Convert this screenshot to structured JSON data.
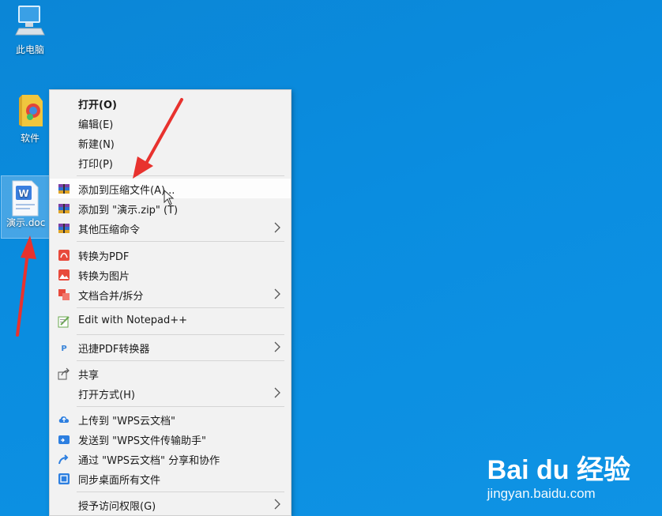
{
  "desktop": {
    "icons": [
      {
        "label": "此电脑",
        "icon": "pc-icon"
      },
      {
        "label": "软件",
        "icon": "folder-icon"
      },
      {
        "label": "演示.doc",
        "icon": "wps-doc-icon"
      }
    ]
  },
  "menu": {
    "items": [
      {
        "label": "打开(O)",
        "bold": true
      },
      {
        "label": "编辑(E)"
      },
      {
        "label": "新建(N)"
      },
      {
        "label": "打印(P)"
      },
      {
        "label": "添加到压缩文件(A)...",
        "icon": "archive-icon",
        "highlighted": true
      },
      {
        "label": "添加到 \"演示.zip\" (T)",
        "icon": "archive-icon"
      },
      {
        "label": "其他压缩命令",
        "icon": "archive-icon",
        "submenu": true
      },
      {
        "label": "转换为PDF",
        "icon": "pdf-convert-icon"
      },
      {
        "label": "转换为图片",
        "icon": "image-convert-icon"
      },
      {
        "label": "文档合并/拆分",
        "icon": "merge-split-icon",
        "submenu": true
      },
      {
        "label": "Edit with Notepad++",
        "icon": "notepadpp-icon"
      },
      {
        "label": "迅捷PDF转换器",
        "icon": "pdf-tool-icon",
        "submenu": true
      },
      {
        "label": "共享",
        "icon": "share-icon"
      },
      {
        "label": "打开方式(H)",
        "submenu": true
      },
      {
        "label": "上传到 \"WPS云文档\"",
        "icon": "cloud-upload-icon"
      },
      {
        "label": "发送到 \"WPS文件传输助手\"",
        "icon": "send-icon"
      },
      {
        "label": "通过 \"WPS云文档\" 分享和协作",
        "icon": "share-collab-icon"
      },
      {
        "label": "同步桌面所有文件",
        "icon": "sync-icon"
      },
      {
        "label": "授予访问权限(G)",
        "submenu": true
      }
    ]
  },
  "watermark": {
    "logo": "Bai du 经验",
    "url": "jingyan.baidu.com"
  },
  "colors": {
    "desktop": "#0a8de0",
    "menu_bg": "#f2f2f2",
    "arrow": "#e8322e"
  }
}
